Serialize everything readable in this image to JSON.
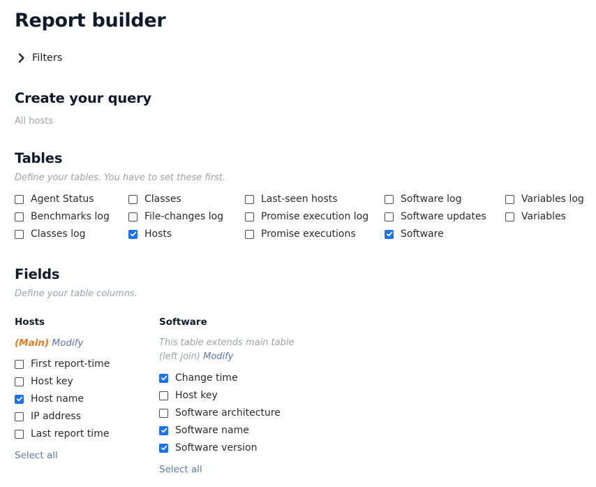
{
  "page": {
    "title": "Report builder"
  },
  "filters": {
    "label": "Filters",
    "icon": "chevron-right-icon"
  },
  "query": {
    "heading": "Create your query",
    "scope": "All hosts"
  },
  "tables": {
    "heading": "Tables",
    "hint": "Define your tables. You have to set these first.",
    "items": [
      {
        "label": "Agent Status",
        "checked": false
      },
      {
        "label": "Benchmarks log",
        "checked": false
      },
      {
        "label": "Classes log",
        "checked": false
      },
      {
        "label": "Classes",
        "checked": false
      },
      {
        "label": "File-changes log",
        "checked": false
      },
      {
        "label": "Hosts",
        "checked": true
      },
      {
        "label": "Last-seen hosts",
        "checked": false
      },
      {
        "label": "Promise execution log",
        "checked": false
      },
      {
        "label": "Promise executions",
        "checked": false
      },
      {
        "label": "Software log",
        "checked": false
      },
      {
        "label": "Software updates",
        "checked": false
      },
      {
        "label": "Software",
        "checked": true
      },
      {
        "label": "Variables log",
        "checked": false
      },
      {
        "label": "Variables",
        "checked": false
      }
    ]
  },
  "fields": {
    "heading": "Fields",
    "hint": "Define your table columns.",
    "hosts": {
      "title": "Hosts",
      "main_label": "(Main)",
      "modify_label": "Modify",
      "items": [
        {
          "label": "First report-time",
          "checked": false
        },
        {
          "label": "Host key",
          "checked": false
        },
        {
          "label": "Host name",
          "checked": true
        },
        {
          "label": "IP address",
          "checked": false
        },
        {
          "label": "Last report time",
          "checked": false
        }
      ],
      "select_all": "Select all"
    },
    "software": {
      "title": "Software",
      "extends_line1": "This table extends main table",
      "extends_line2": "(left join)",
      "modify_label": "Modify",
      "items": [
        {
          "label": "Change time",
          "checked": true
        },
        {
          "label": "Host key",
          "checked": false
        },
        {
          "label": "Software architecture",
          "checked": false
        },
        {
          "label": "Software name",
          "checked": true
        },
        {
          "label": "Software version",
          "checked": true
        }
      ],
      "select_all": "Select all"
    }
  },
  "colors": {
    "accent": "#1a73e8",
    "link": "#5a79a8",
    "main_tag": "#e07b22",
    "muted": "#9ca2a8"
  }
}
